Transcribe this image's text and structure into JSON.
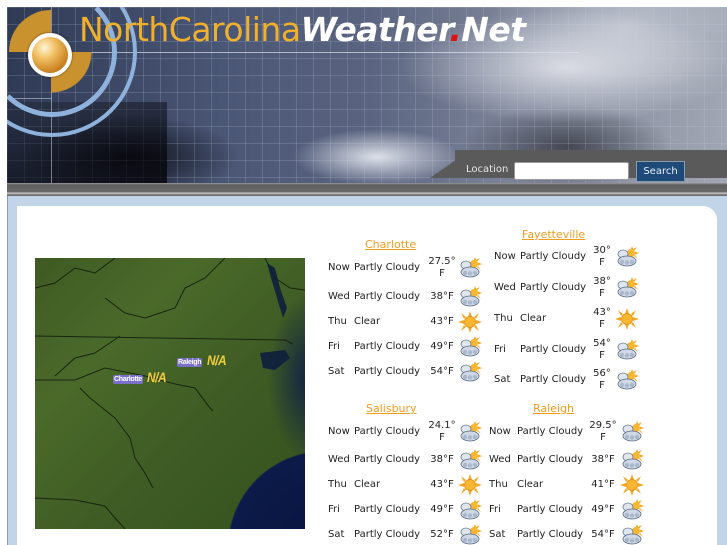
{
  "header": {
    "title_part1": "NorthCarolina",
    "title_part2": "Weather",
    "title_dot": ".",
    "title_part3": "Net"
  },
  "search": {
    "label": "Location",
    "value": "",
    "placeholder": "",
    "button_label": "Search"
  },
  "map": {
    "labels": [
      {
        "city": "Raleigh",
        "value": "N/A"
      },
      {
        "city": "Charlotte",
        "value": "N/A"
      }
    ]
  },
  "forecasts": [
    {
      "city": "Charlotte",
      "rows": [
        {
          "day": "Now",
          "condition": "Partly Cloudy",
          "temp": "27.5°F",
          "icon": "partly-cloudy-icon"
        },
        {
          "day": "Wed",
          "condition": "Partly Cloudy",
          "temp": "38°F",
          "icon": "partly-cloudy-icon"
        },
        {
          "day": "Thu",
          "condition": "Clear",
          "temp": "43°F",
          "icon": "sun-icon"
        },
        {
          "day": "Fri",
          "condition": "Partly Cloudy",
          "temp": "49°F",
          "icon": "partly-cloudy-icon"
        },
        {
          "day": "Sat",
          "condition": "Partly Cloudy",
          "temp": "54°F",
          "icon": "partly-cloudy-icon"
        }
      ]
    },
    {
      "city": "Fayetteville",
      "rows": [
        {
          "day": "Now",
          "condition": "Partly Cloudy",
          "temp": "30°F",
          "icon": "partly-cloudy-icon"
        },
        {
          "day": "Wed",
          "condition": "Partly Cloudy",
          "temp": "38°F",
          "icon": "partly-cloudy-icon"
        },
        {
          "day": "Thu",
          "condition": "Clear",
          "temp": "43°F",
          "icon": "sun-icon"
        },
        {
          "day": "Fri",
          "condition": "Partly Cloudy",
          "temp": "54°F",
          "icon": "partly-cloudy-icon"
        },
        {
          "day": "Sat",
          "condition": "Partly Cloudy",
          "temp": "56°F",
          "icon": "partly-cloudy-icon"
        }
      ]
    },
    {
      "city": "Salisbury",
      "rows": [
        {
          "day": "Now",
          "condition": "Partly Cloudy",
          "temp": "24.1°F",
          "icon": "partly-cloudy-icon"
        },
        {
          "day": "Wed",
          "condition": "Partly Cloudy",
          "temp": "38°F",
          "icon": "partly-cloudy-icon"
        },
        {
          "day": "Thu",
          "condition": "Clear",
          "temp": "43°F",
          "icon": "sun-icon"
        },
        {
          "day": "Fri",
          "condition": "Partly Cloudy",
          "temp": "49°F",
          "icon": "partly-cloudy-icon"
        },
        {
          "day": "Sat",
          "condition": "Partly Cloudy",
          "temp": "52°F",
          "icon": "partly-cloudy-icon"
        }
      ]
    },
    {
      "city": "Raleigh",
      "rows": [
        {
          "day": "Now",
          "condition": "Partly Cloudy",
          "temp": "29.5°F",
          "icon": "partly-cloudy-icon"
        },
        {
          "day": "Wed",
          "condition": "Partly Cloudy",
          "temp": "38°F",
          "icon": "partly-cloudy-icon"
        },
        {
          "day": "Thu",
          "condition": "Clear",
          "temp": "41°F",
          "icon": "sun-icon"
        },
        {
          "day": "Fri",
          "condition": "Partly Cloudy",
          "temp": "49°F",
          "icon": "partly-cloudy-icon"
        },
        {
          "day": "Sat",
          "condition": "Partly Cloudy",
          "temp": "54°F",
          "icon": "partly-cloudy-icon"
        }
      ]
    }
  ],
  "colors": {
    "accent_orange": "#f09c1c",
    "title_gold": "#f0b02a",
    "search_button": "#1e4a7a",
    "frame_blue": "#c2d4e8"
  }
}
